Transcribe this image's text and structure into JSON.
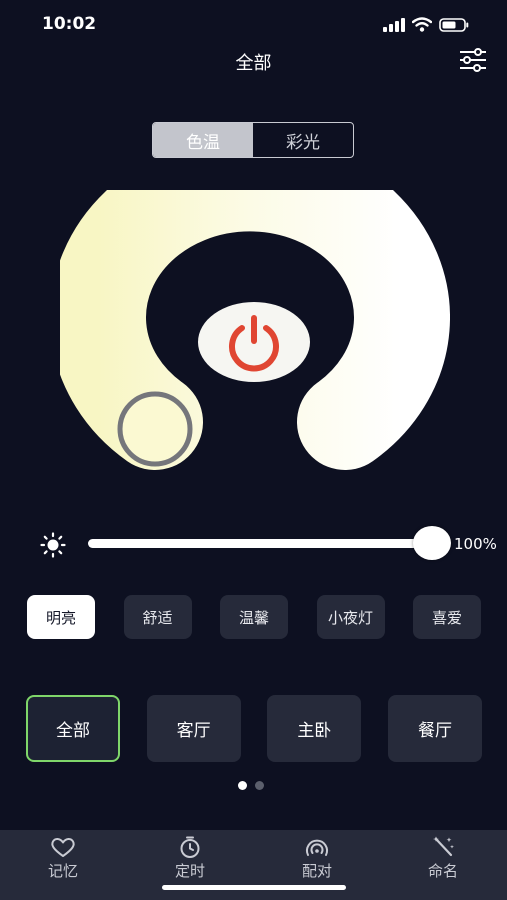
{
  "status": {
    "time": "10:02"
  },
  "header": {
    "title": "全部"
  },
  "mode_tabs": [
    {
      "label": "色温",
      "active": true
    },
    {
      "label": "彩光",
      "active": false
    }
  ],
  "brightness": {
    "value": 100,
    "label": "100%"
  },
  "scenes": [
    {
      "label": "明亮",
      "active": true
    },
    {
      "label": "舒适",
      "active": false
    },
    {
      "label": "温馨",
      "active": false
    },
    {
      "label": "小夜灯",
      "active": false
    },
    {
      "label": "喜爱",
      "active": false
    }
  ],
  "rooms": [
    {
      "label": "全部",
      "active": true
    },
    {
      "label": "客厅",
      "active": false
    },
    {
      "label": "主卧",
      "active": false
    },
    {
      "label": "餐厅",
      "active": false
    }
  ],
  "pager": {
    "pages": 2,
    "current": 1
  },
  "tabbar": [
    {
      "label": "记忆",
      "icon": "heart-icon"
    },
    {
      "label": "定时",
      "icon": "timer-icon"
    },
    {
      "label": "配对",
      "icon": "signal-icon"
    },
    {
      "label": "命名",
      "icon": "magic-wand-icon"
    }
  ],
  "colors": {
    "background": "#0d1021",
    "wheel_warm": "#fbf9d0",
    "wheel_cool": "#ffffff",
    "power_icon": "#e04632",
    "room_active_border": "#7fd66a"
  }
}
